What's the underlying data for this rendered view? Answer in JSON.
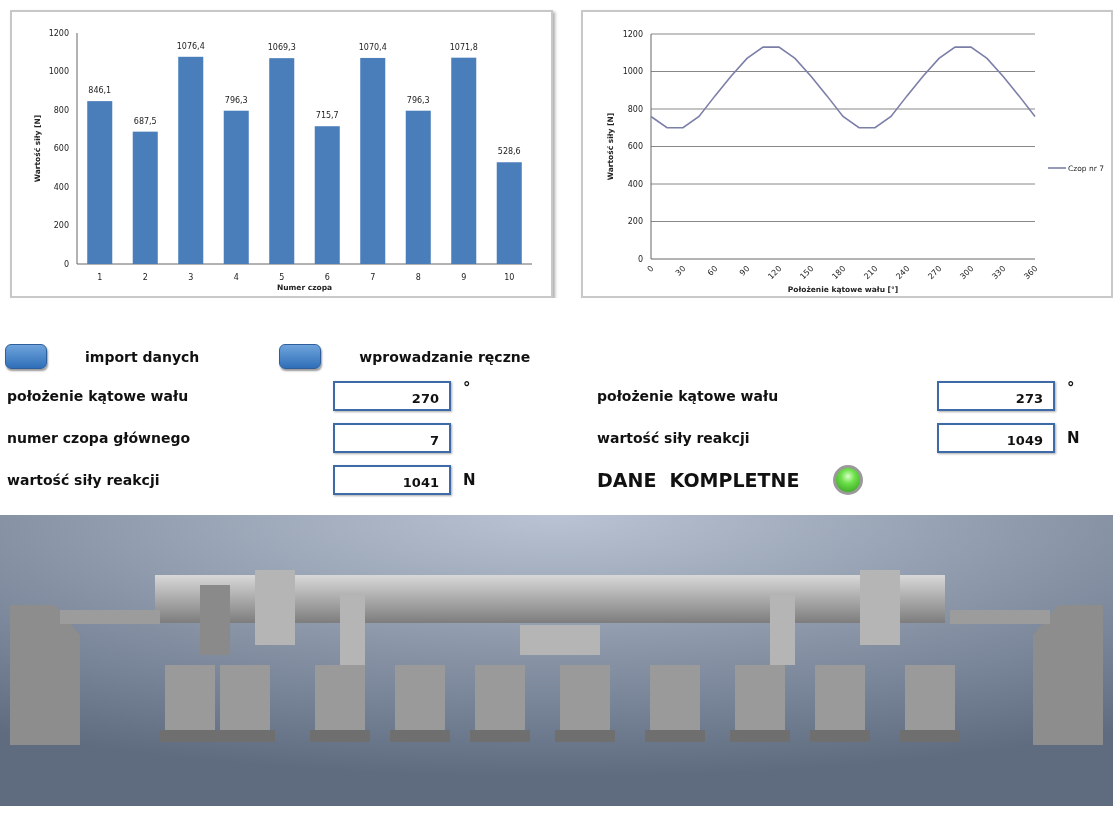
{
  "bar_chart": {
    "chart_data": {
      "type": "bar",
      "xlabel": "Numer czopa",
      "ylabel": "Wartość siły [N]",
      "categories": [
        "1",
        "2",
        "3",
        "4",
        "5",
        "6",
        "7",
        "8",
        "9",
        "10"
      ],
      "series": [
        {
          "color": "#4a7ebb",
          "values": [
            846.1,
            687.5,
            1076.4,
            796.3,
            1069.3,
            715.7,
            1070.4,
            796.3,
            1071.8,
            528.6
          ]
        }
      ],
      "value_labels": [
        "846,1",
        "687,5",
        "1076,4",
        "796,3",
        "1069,3",
        "715,7",
        "1070,4",
        "796,3",
        "1071,8",
        "528,6"
      ],
      "ylim": [
        0,
        1200
      ],
      "yticks": [
        0,
        200,
        400,
        600,
        800,
        1000,
        1200
      ]
    }
  },
  "line_chart": {
    "chart_data": {
      "type": "line",
      "xlabel": "Położenie kątowe wału [°]",
      "ylabel": "Wartość siły [N]",
      "x": [
        0,
        15,
        30,
        45,
        60,
        75,
        90,
        105,
        120,
        135,
        150,
        165,
        180,
        195,
        210,
        225,
        240,
        255,
        270,
        285,
        300,
        315,
        330,
        345,
        360
      ],
      "series": [
        {
          "name": "Czop nr 7",
          "color": "#7b7fa8",
          "values": [
            760,
            700,
            700,
            760,
            870,
            975,
            1070,
            1130,
            1130,
            1070,
            975,
            870,
            760,
            700,
            700,
            760,
            870,
            975,
            1070,
            1130,
            1130,
            1070,
            975,
            870,
            760
          ]
        }
      ],
      "xlim": [
        0,
        360
      ],
      "ylim": [
        0,
        1200
      ],
      "grid": true,
      "xticks": [
        0,
        30,
        60,
        90,
        120,
        150,
        180,
        210,
        240,
        270,
        300,
        330,
        360
      ],
      "yticks": [
        0,
        200,
        400,
        600,
        800,
        1000,
        1200
      ]
    }
  },
  "mode_buttons": [
    {
      "label": "import danych"
    },
    {
      "label": "wprowadzanie ręczne"
    }
  ],
  "left_fields": [
    {
      "label": "położenie kątowe wału",
      "value": "270",
      "unit": "°"
    },
    {
      "label": "numer czopa głównego",
      "value": "7"
    },
    {
      "label": "wartość siły reakcji",
      "value": "1041",
      "unit": "N"
    }
  ],
  "right_fields": [
    {
      "label": "położenie kątowe wału",
      "value": "273",
      "unit": "°"
    },
    {
      "label": "wartość siły reakcji",
      "value": "1049",
      "unit": "N"
    }
  ],
  "status": {
    "label": "DANE  KOMPLETNE",
    "on": true
  }
}
